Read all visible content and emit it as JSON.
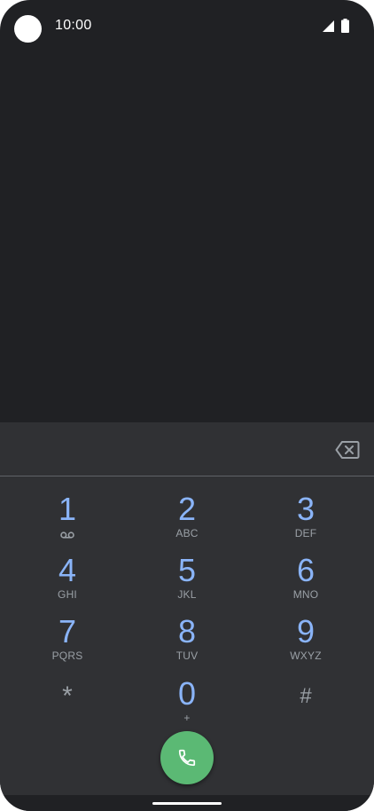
{
  "status_bar": {
    "time": "10:00",
    "icons": [
      "camera-cutout",
      "signal-icon",
      "battery-icon"
    ]
  },
  "dialer": {
    "number_value": "",
    "backspace_icon": "backspace-icon",
    "keys": [
      {
        "digit": "1",
        "letters": "",
        "extra_icon": "voicemail-icon"
      },
      {
        "digit": "2",
        "letters": "ABC"
      },
      {
        "digit": "3",
        "letters": "DEF"
      },
      {
        "digit": "4",
        "letters": "GHI"
      },
      {
        "digit": "5",
        "letters": "JKL"
      },
      {
        "digit": "6",
        "letters": "MNO"
      },
      {
        "digit": "7",
        "letters": "PQRS"
      },
      {
        "digit": "8",
        "letters": "TUV"
      },
      {
        "digit": "9",
        "letters": "WXYZ"
      },
      {
        "digit": "*",
        "letters": ""
      },
      {
        "digit": "0",
        "letters": "+"
      },
      {
        "digit": "#",
        "letters": ""
      }
    ],
    "call_icon": "phone-icon"
  },
  "colors": {
    "background": "#202124",
    "panel": "#303134",
    "digit": "#8ab4f8",
    "letters": "#9aa0a6",
    "call_button": "#5bb974"
  }
}
